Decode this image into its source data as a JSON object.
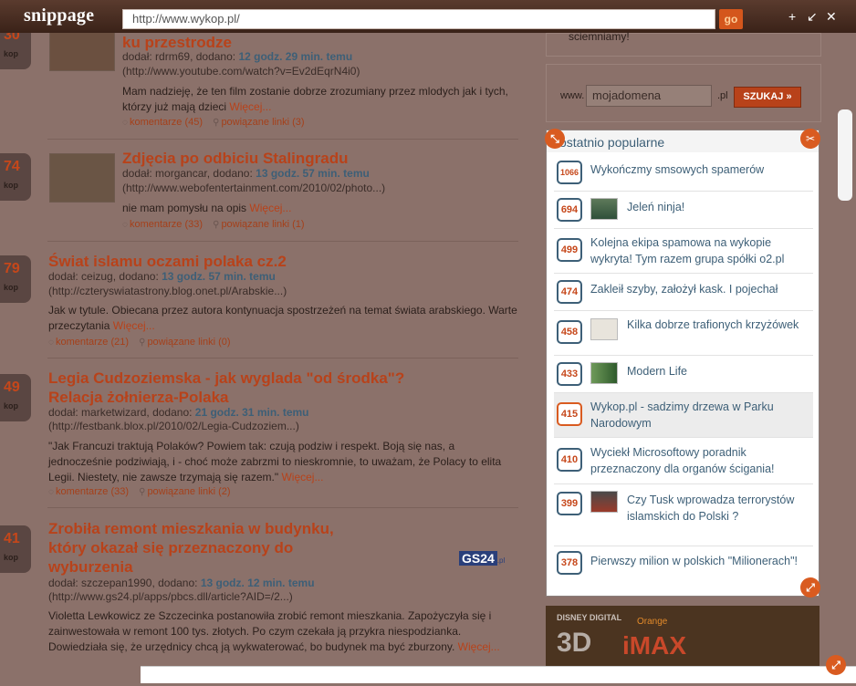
{
  "toolbar": {
    "logo": "snippage",
    "url": "http://www.wykop.pl/",
    "go_label": "go",
    "win_plus": "+",
    "win_shrink": "↙",
    "win_close": "✕"
  },
  "feed": {
    "entries": [
      {
        "count": "30",
        "count_label": "kop",
        "title_line1": "ku przestrodze",
        "title_line2": "",
        "added_by_label": "dodał:",
        "user": "rdrm69",
        "added_label": ", dodano:",
        "time": "12 godz. 29 min. temu",
        "url": "(http://www.youtube.com/watch?v=Ev2dEqrN4i0)",
        "desc": "Mam nadzieję, że ten film zostanie dobrze zrozumiany przez mlodych jak i tych, którzy już mają dzieci",
        "more": "Więcej...",
        "comments": "komentarze (45)",
        "related": "powiązane linki (3)"
      },
      {
        "count": "74",
        "count_label": "kop",
        "title_line1": "Zdjęcia po odbiciu Stalingradu",
        "title_line2": "",
        "added_by_label": "dodał:",
        "user": "morgancar",
        "added_label": ", dodano:",
        "time": "13 godz. 57 min. temu",
        "url": "(http://www.webofentertainment.com/2010/02/photo...)",
        "desc": "nie mam pomysłu na opis",
        "more": "Więcej...",
        "comments": "komentarze (33)",
        "related": "powiązane linki (1)"
      },
      {
        "count": "79",
        "count_label": "kop",
        "title_line1": "Świat islamu oczami polaka cz.2",
        "title_line2": "",
        "added_by_label": "dodał:",
        "user": "ceizug",
        "added_label": ", dodano:",
        "time": "13 godz. 57 min. temu",
        "url": "(http://czteryswiatastrony.blog.onet.pl/Arabskie...)",
        "desc": "Jak w tytule. Obiecana przez autora kontynuacja spostrzeżeń na temat świata arabskiego. Warte przeczytania",
        "more": "Więcej...",
        "comments": "komentarze (21)",
        "related": "powiązane linki (0)"
      },
      {
        "count": "49",
        "count_label": "kop",
        "title_line1": "Legia Cudzoziemska - jak wyglada \"od środka\"?",
        "title_line2": "Relacja żołnierza-Polaka",
        "added_by_label": "dodał:",
        "user": "marketwizard",
        "added_label": ", dodano:",
        "time": "21 godz. 31 min. temu",
        "url": "(http://festbank.blox.pl/2010/02/Legia-Cudzoziem...)",
        "desc": "\"Jak Francuzi traktują Polaków? Powiem tak: czują podziw i respekt. Boją się nas, a jednocześnie podziwiają, i - choć może zabrzmi to nieskromnie, to uważam, że Polacy to elita Legii. Niestety, nie zawsze trzymają się razem.\"",
        "more": "Więcej...",
        "comments": "komentarze (33)",
        "related": "powiązane linki (2)"
      },
      {
        "count": "41",
        "count_label": "kop",
        "title_line1": "Zrobiła remont mieszkania w budynku,",
        "title_line2": "który okazał się przeznaczony do",
        "title_line3": "wyburzenia",
        "added_by_label": "dodał:",
        "user": "szczepan1990",
        "added_label": ", dodano:",
        "time": "13 godz. 12 min. temu",
        "url": "(http://www.gs24.pl/apps/pbcs.dll/article?AID=/2...)",
        "desc": "Violetta Lewkowicz ze Szczecinka postanowiła zrobić remont mieszkania. Zapożyczyła się i zainwestowała w remont 100 tys. złotych. Po czym czekała ją przykra niespodzianka. Dowiedziała się, że urzędnicy chcą ją wykwaterować, bo budynek ma być zburzony.",
        "more": "Więcej...",
        "source_logo": "GS24",
        "source_logo_suffix": ".pl"
      }
    ]
  },
  "sidebar": {
    "top_text": "sciemniamy!",
    "domain": {
      "prefix": "www.",
      "value": "mojadomena",
      "suffix": ".pl",
      "button": "SZUKAJ"
    },
    "popular": {
      "title": "ostatnio popularne",
      "items": [
        {
          "count": "1066",
          "text": "Wykończmy smsowych spamerów",
          "thumb": false,
          "highlight": false
        },
        {
          "count": "694",
          "text": "Jeleń ninja!",
          "thumb": true,
          "highlight": false
        },
        {
          "count": "499",
          "text": "Kolejna ekipa spamowa na wykopie wykryta! Tym razem grupa spółki o2.pl",
          "thumb": false,
          "highlight": false
        },
        {
          "count": "474",
          "text": "Zakleił szyby, założył kask. I pojechał",
          "thumb": false,
          "highlight": false
        },
        {
          "count": "458",
          "text": "Kilka dobrze trafionych krzyżówek",
          "thumb": true,
          "highlight": false
        },
        {
          "count": "433",
          "text": "Modern Life",
          "thumb": true,
          "highlight": false
        },
        {
          "count": "415",
          "text": "Wykop.pl - sadzimy drzewa w Parku Narodowym",
          "thumb": false,
          "highlight": true
        },
        {
          "count": "410",
          "text": "Wyciekł Microsoftowy poradnik przeznaczony dla organów ścigania!",
          "thumb": false,
          "highlight": false
        },
        {
          "count": "399",
          "text": "Czy Tusk wprowadza terrorystów islamskich do Polski ?",
          "thumb": true,
          "highlight": false
        },
        {
          "count": "378",
          "text": "Pierwszy milion w polskich \"Milionerach\"!",
          "thumb": false,
          "highlight": false
        }
      ]
    },
    "ad": {
      "small": "DISNEY DIGITAL",
      "brand": "Orange",
      "d3": "3D",
      "imax": "iMAX"
    }
  },
  "colors": {
    "accent": "#b8421a",
    "link_blue": "#3d5f77",
    "handle_orange": "#d95b20"
  }
}
